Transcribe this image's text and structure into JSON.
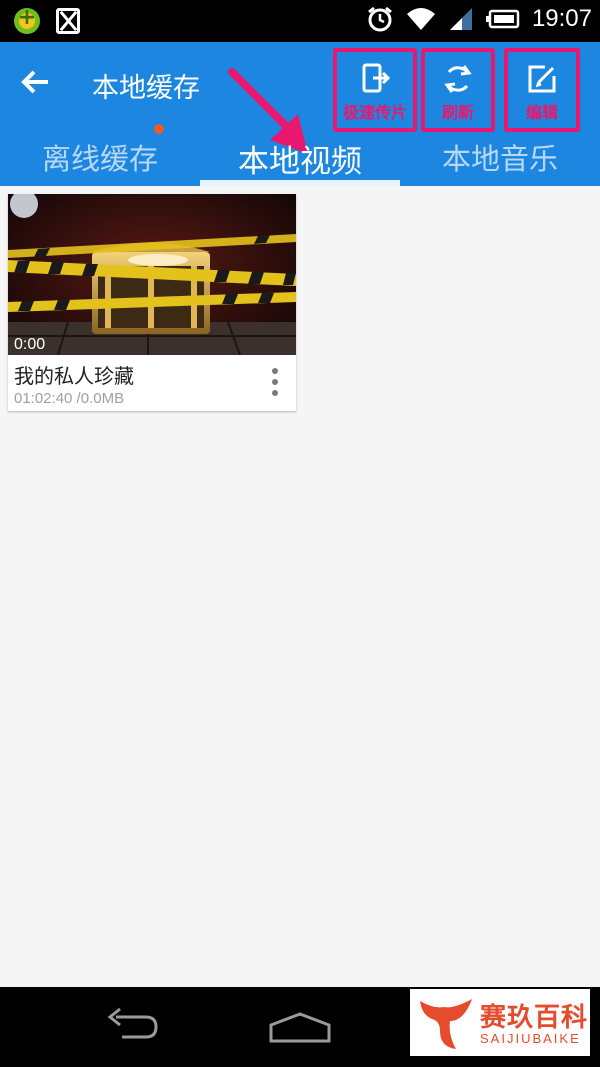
{
  "status_bar": {
    "time": "19:07",
    "icons": [
      "app-360-icon",
      "app-game-icon",
      "alarm-icon",
      "wifi-icon",
      "signal-icon",
      "battery-icon"
    ]
  },
  "header": {
    "title": "本地缓存",
    "actions": [
      {
        "label": "极速传片",
        "icon": "transfer-icon"
      },
      {
        "label": "刷新",
        "icon": "refresh-icon"
      },
      {
        "label": "编辑",
        "icon": "edit-icon"
      }
    ]
  },
  "tabs": [
    {
      "label": "离线缓存",
      "selected": false,
      "has_badge": true
    },
    {
      "label": "本地视频",
      "selected": true
    },
    {
      "label": "本地音乐",
      "selected": false
    }
  ],
  "videos": [
    {
      "title": "我的私人珍藏",
      "duration": "0:00",
      "meta": "01:02:40 /0.0MB"
    }
  ],
  "watermark": {
    "brand": "赛玖百科",
    "latin": "SAIJIUBAIKE"
  },
  "colors": {
    "appbar": "#1c86e0",
    "highlight": "#e8186e",
    "badge": "#ee5a2f"
  }
}
